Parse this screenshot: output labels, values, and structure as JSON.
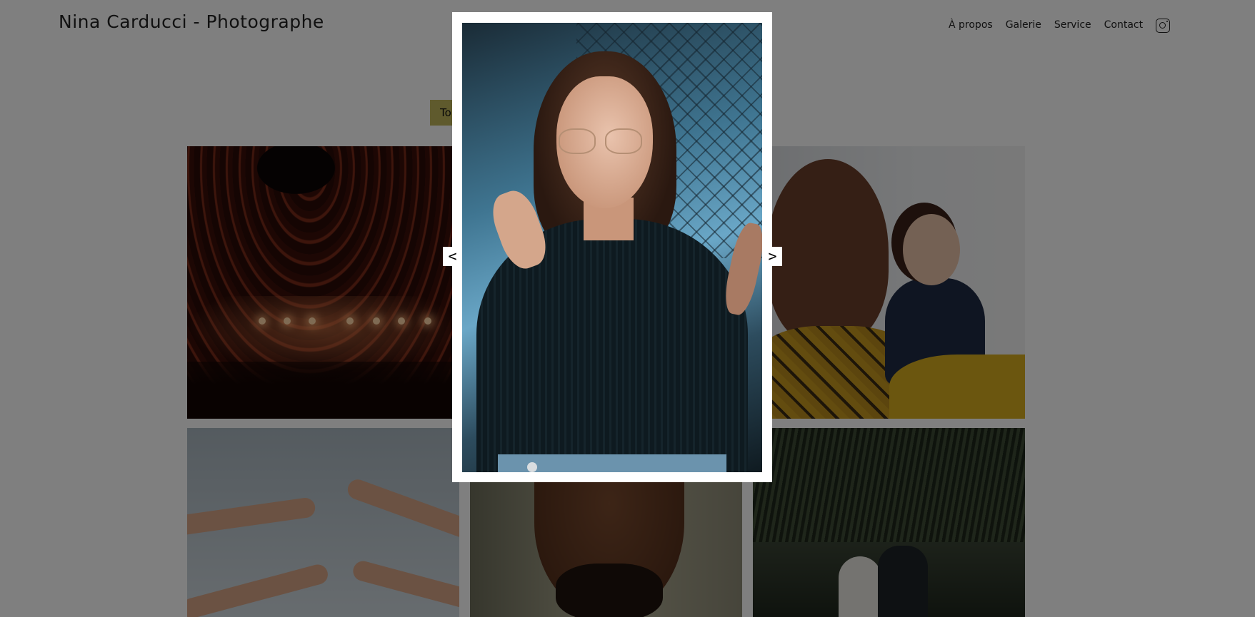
{
  "header": {
    "site_title": "Nina Carducci - Photographe",
    "nav": [
      "À propos",
      "Galerie",
      "Service",
      "Contact"
    ],
    "social_icon": "instagram-icon"
  },
  "gallery": {
    "filters": {
      "active_label": "To"
    },
    "items": [
      "concert",
      "meeting",
      "hands",
      "portrait-man",
      "wedding"
    ]
  },
  "lightbox": {
    "open": true,
    "image": "portrait-woman-glasses",
    "prev_label": "<",
    "next_label": ">"
  },
  "colors": {
    "overlay": "#000000",
    "filter_active": "#BEB45A",
    "modal_bg": "#FFFFFF"
  }
}
